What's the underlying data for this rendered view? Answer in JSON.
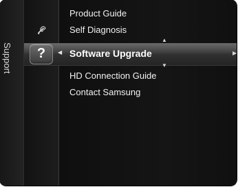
{
  "menu": {
    "section_label": "Support",
    "items": [
      {
        "label": "Product Guide"
      },
      {
        "label": "Self Diagnosis"
      },
      {
        "label": "Software Upgrade",
        "selected": true
      },
      {
        "label": "HD Connection Guide"
      },
      {
        "label": "Contact Samsung"
      }
    ],
    "icons": {
      "section_icon": "wrench-icon",
      "selected_icon": "help-icon",
      "selected_icon_text": "?",
      "left_indicator": "left-arrow-icon",
      "right_indicator": "right-arrow-icon",
      "up_indicator": "up-arrow-icon",
      "down_indicator": "down-arrow-icon"
    }
  },
  "colors": {
    "background": "#111111",
    "text": "#f2f2f2",
    "selected_text": "#ffffff",
    "highlight": "#3a3a3a"
  }
}
